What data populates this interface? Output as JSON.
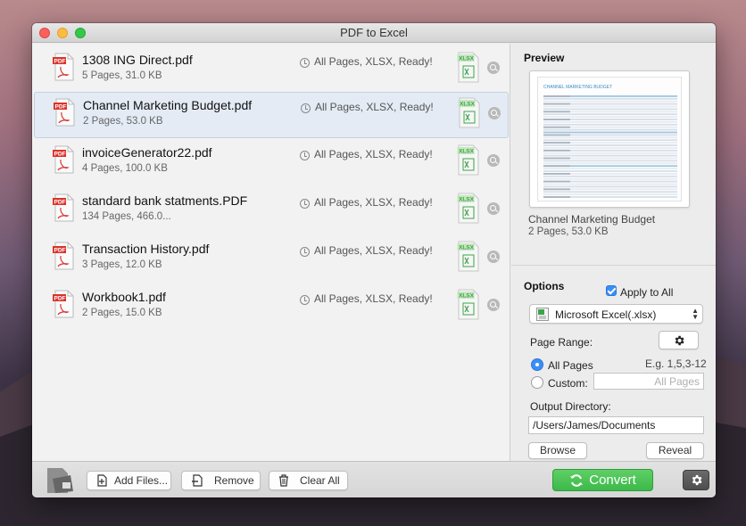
{
  "window": {
    "title": "PDF to Excel"
  },
  "files": [
    {
      "name": "1308 ING Direct.pdf",
      "meta": "5 Pages, 31.0 KB",
      "status": "All Pages, XLSX, Ready!"
    },
    {
      "name": "Channel Marketing Budget.pdf",
      "meta": "2 Pages, 53.0 KB",
      "status": "All Pages, XLSX, Ready!"
    },
    {
      "name": "invoiceGenerator22.pdf",
      "meta": "4 Pages, 100.0 KB",
      "status": "All Pages, XLSX, Ready!"
    },
    {
      "name": "standard bank statments.PDF",
      "meta": "134 Pages, 466.0...",
      "status": "All Pages, XLSX, Ready!"
    },
    {
      "name": "Transaction History.pdf",
      "meta": "3 Pages, 12.0 KB",
      "status": "All Pages, XLSX, Ready!"
    },
    {
      "name": "Workbook1.pdf",
      "meta": "2 Pages, 15.0 KB",
      "status": "All Pages, XLSX, Ready!"
    }
  ],
  "selected_index": 1,
  "preview": {
    "title": "Preview",
    "doc_name": "Channel Marketing Budget",
    "doc_meta": "2 Pages, 53.0 KB",
    "sheet_title": "CHANNEL MARKETING BUDGET"
  },
  "options": {
    "title": "Options",
    "apply_to_all_label": "Apply to All",
    "apply_to_all": true,
    "format": "Microsoft Excel(.xlsx)",
    "page_range_label": "Page Range:",
    "all_pages_label": "All Pages",
    "example_hint": "E.g. 1,5,3-12",
    "custom_label": "Custom:",
    "custom_placeholder": "All Pages",
    "output_dir_label": "Output Directory:",
    "output_dir": "/Users/James/Documents",
    "browse_label": "Browse",
    "reveal_label": "Reveal"
  },
  "toolbar": {
    "add_files": "Add Files...",
    "remove": "Remove",
    "clear_all": "Clear All",
    "convert": "Convert"
  },
  "colors": {
    "accent": "#3b8ef5",
    "convert_green": "#3cb94a",
    "pdf_red": "#d9342b",
    "xlsx_green": "#3aa54a",
    "selection": "#e4ebf5"
  }
}
